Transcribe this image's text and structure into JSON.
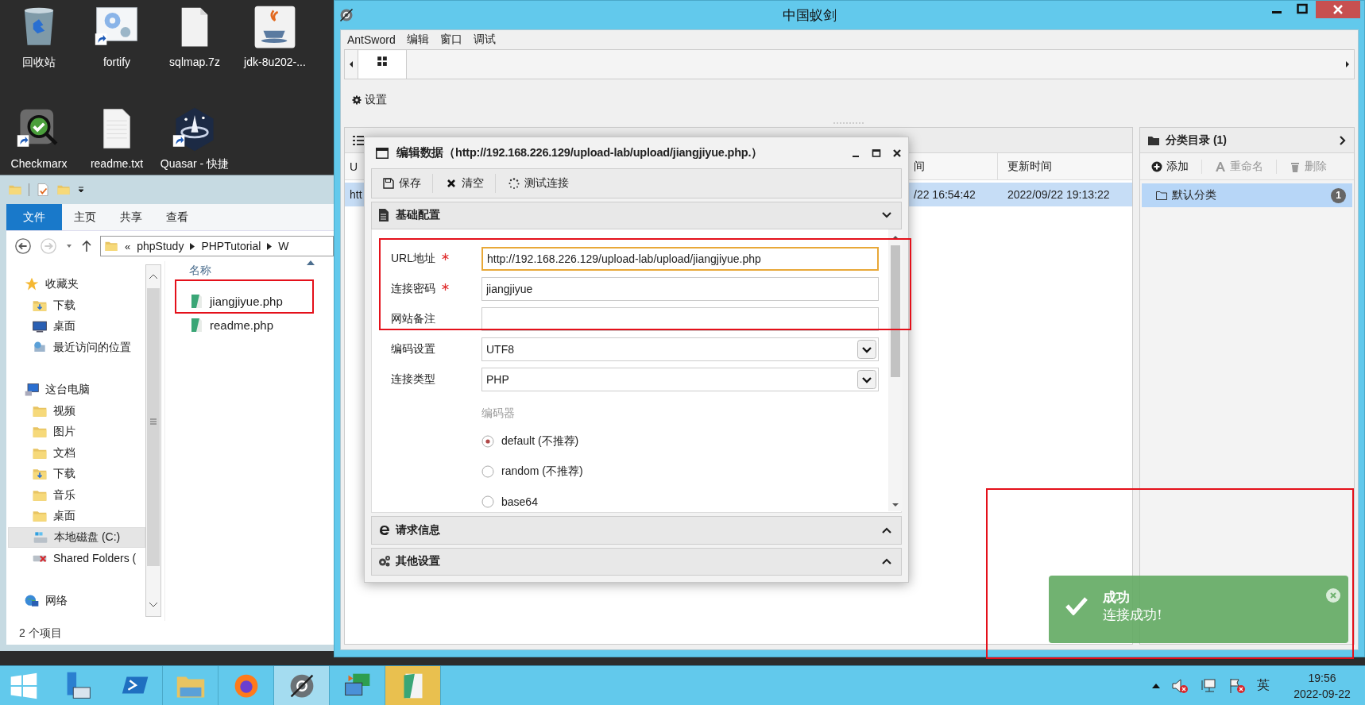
{
  "desktop": {
    "icons": [
      {
        "label": "回收站",
        "kind": "recycle"
      },
      {
        "label": "fortify",
        "kind": "gears"
      },
      {
        "label": "sqlmap.7z",
        "kind": "file"
      },
      {
        "label": "jdk-8u202-...",
        "kind": "java"
      },
      {
        "label": "Checkmarx",
        "kind": "checkmarx"
      },
      {
        "label": "readme.txt",
        "kind": "text"
      },
      {
        "label": "Quasar - 快捷",
        "kind": "quasar"
      }
    ]
  },
  "explorer": {
    "ribbon_tabs": [
      {
        "label": "文件",
        "selected": true
      },
      {
        "label": "主页",
        "selected": false
      },
      {
        "label": "共享",
        "selected": false
      },
      {
        "label": "查看",
        "selected": false
      }
    ],
    "breadcrumb_prefix": "«",
    "breadcrumb": [
      "phpStudy",
      "PHPTutorial",
      "W"
    ],
    "nav": [
      {
        "label": "收藏夹",
        "kind": "star",
        "selected": false,
        "children": [
          {
            "label": "下载",
            "kind": "download",
            "selected": false
          },
          {
            "label": "桌面",
            "kind": "desktop",
            "selected": false
          },
          {
            "label": "最近访问的位置",
            "kind": "recent",
            "selected": false
          }
        ]
      },
      {
        "label": "这台电脑",
        "kind": "computer",
        "selected": false,
        "children": [
          {
            "label": "视频",
            "kind": "folder",
            "selected": false
          },
          {
            "label": "图片",
            "kind": "folder",
            "selected": false
          },
          {
            "label": "文档",
            "kind": "folder",
            "selected": false
          },
          {
            "label": "下载",
            "kind": "download",
            "selected": false
          },
          {
            "label": "音乐",
            "kind": "folder",
            "selected": false
          },
          {
            "label": "桌面",
            "kind": "folder",
            "selected": false
          },
          {
            "label": "本地磁盘 (C:)",
            "kind": "drive",
            "selected": true
          },
          {
            "label": "Shared Folders (",
            "kind": "share",
            "selected": false
          }
        ]
      },
      {
        "label": "网络",
        "kind": "network",
        "selected": false
      }
    ],
    "column": "名称",
    "files": [
      "jiangjiyue.php",
      "readme.php"
    ],
    "status": "2 个项目"
  },
  "antsword": {
    "title": "中国蚁剑",
    "menu": [
      "AntSword",
      "编辑",
      "窗口",
      "调试"
    ],
    "toolbar": [
      "设置"
    ],
    "data_table": {
      "columns": [
        "U",
        "间",
        "更新时间"
      ],
      "rows": [
        {
          "cells": [
            "htt",
            "/22 16:54:42",
            "2022/09/22 19:13:22"
          ],
          "selected": true
        }
      ]
    },
    "categories": {
      "title": "分类目录 (1)",
      "buttons": [
        {
          "label": "添加",
          "kind": "add",
          "disabled": false
        },
        {
          "label": "重命名",
          "kind": "rename",
          "disabled": true
        },
        {
          "label": "删除",
          "kind": "delete",
          "disabled": true
        }
      ],
      "items": [
        {
          "label": "默认分类",
          "count": "1",
          "selected": true
        }
      ]
    }
  },
  "dialog": {
    "title": "编辑数据（http://192.168.226.129/upload-lab/upload/jiangjiyue.php.）",
    "toolbar": [
      {
        "label": "保存",
        "kind": "save"
      },
      {
        "label": "清空",
        "kind": "clear"
      },
      {
        "label": "测试连接",
        "kind": "test"
      }
    ],
    "basic": {
      "title": "基础配置",
      "expanded": true,
      "fields": [
        {
          "label": "URL地址",
          "kind": "text",
          "required": true,
          "focused": true,
          "value": "http://192.168.226.129/upload-lab/upload/jiangjiyue.php"
        },
        {
          "label": "连接密码",
          "kind": "text",
          "required": true,
          "focused": false,
          "value": "jiangjiyue"
        },
        {
          "label": "网站备注",
          "kind": "text",
          "required": false,
          "focused": false
        },
        {
          "label": "编码设置",
          "kind": "select",
          "required": false,
          "focused": false,
          "value": "UTF8"
        },
        {
          "label": "连接类型",
          "kind": "select",
          "required": false,
          "focused": false,
          "value": "PHP"
        }
      ],
      "encoder": {
        "label": "编码器",
        "options": [
          {
            "label": "default (不推荐)",
            "selected": true
          },
          {
            "label": "random (不推荐)",
            "selected": false
          },
          {
            "label": "base64",
            "selected": false
          }
        ]
      }
    },
    "sections": [
      {
        "title": "请求信息",
        "kind": "request",
        "expanded": false
      },
      {
        "title": "其他设置",
        "kind": "other",
        "expanded": false
      }
    ]
  },
  "toast": {
    "title": "成功",
    "message": "连接成功!"
  },
  "taskbar": {
    "apps": [
      {
        "kind": "start",
        "active": false,
        "highlighted": false
      },
      {
        "kind": "server",
        "active": false,
        "highlighted": false
      },
      {
        "kind": "powershell",
        "active": false,
        "highlighted": false
      },
      {
        "kind": "explorer",
        "active": false,
        "highlighted": false
      },
      {
        "kind": "firefox",
        "active": false,
        "highlighted": false
      },
      {
        "kind": "antsword",
        "active": true,
        "highlighted": false
      },
      {
        "kind": "remote",
        "active": false,
        "highlighted": false
      },
      {
        "kind": "notepad",
        "active": false,
        "highlighted": true
      }
    ],
    "language": "英",
    "time": "19:56",
    "date": "2022-09-22"
  }
}
